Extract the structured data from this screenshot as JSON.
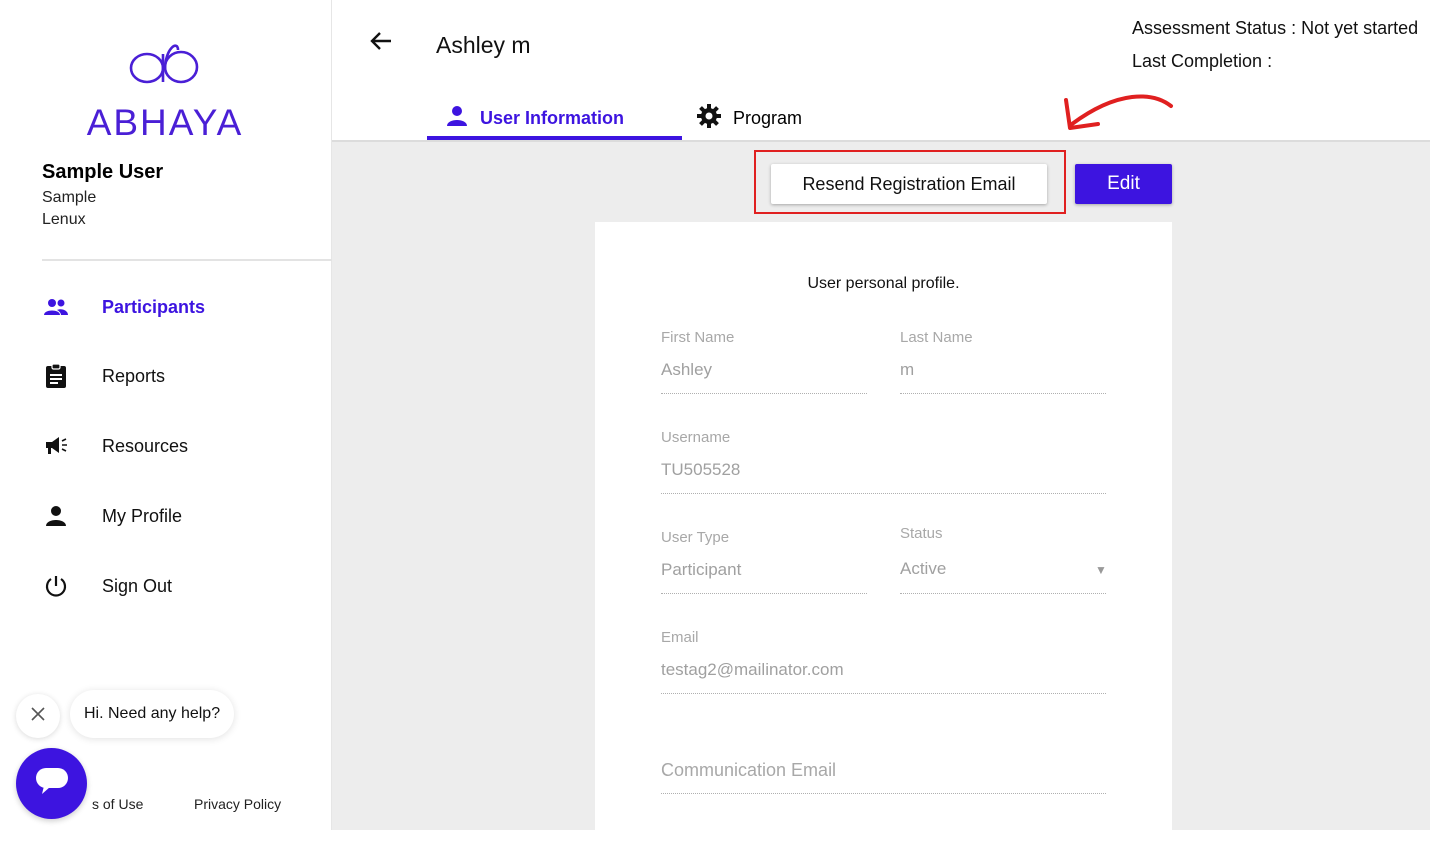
{
  "brand": {
    "name": "ABHAYA",
    "color": "#3d14e0"
  },
  "user": {
    "name": "Sample User",
    "line1": "Sample",
    "line2": "Lenux"
  },
  "sidebar": {
    "items": [
      {
        "label": "Participants",
        "icon": "participants-icon",
        "active": true
      },
      {
        "label": "Reports",
        "icon": "clipboard-icon",
        "active": false
      },
      {
        "label": "Resources",
        "icon": "megaphone-icon",
        "active": false
      },
      {
        "label": "My Profile",
        "icon": "person-icon",
        "active": false
      },
      {
        "label": "Sign Out",
        "icon": "power-icon",
        "active": false
      }
    ]
  },
  "chat": {
    "greeting": "Hi. Need any help?",
    "close_icon": "close-icon",
    "launcher_icon": "chat-icon"
  },
  "footer": {
    "terms": "s of Use",
    "privacy": "Privacy Policy"
  },
  "header": {
    "title": "Ashley m",
    "assessment_status": "Assessment Status : Not yet started",
    "last_completion": "Last Completion :",
    "back_icon": "arrow-left-icon"
  },
  "tabs": [
    {
      "label": "User Information",
      "icon": "person-icon",
      "active": true
    },
    {
      "label": "Program",
      "icon": "gear-icon",
      "active": false
    }
  ],
  "actions": {
    "resend_label": "Resend Registration Email",
    "edit_label": "Edit"
  },
  "profile": {
    "title": "User personal profile.",
    "first_name_label": "First Name",
    "first_name": "Ashley",
    "last_name_label": "Last Name",
    "last_name": "m",
    "username_label": "Username",
    "username": "TU505528",
    "user_type_label": "User Type",
    "user_type": "Participant",
    "status_label": "Status",
    "status": "Active",
    "email_label": "Email",
    "email": "testag2@mailinator.com",
    "communication_email_placeholder": "Communication Email"
  },
  "colors": {
    "accent": "#3d14e0",
    "highlight": "#e02020",
    "background": "#ededed"
  }
}
